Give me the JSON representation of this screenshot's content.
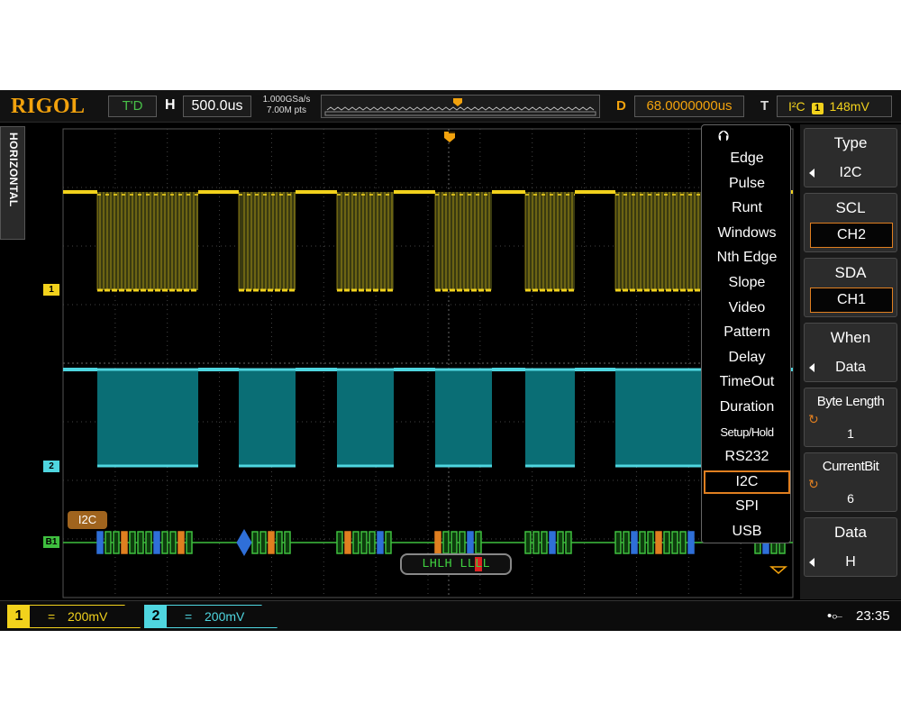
{
  "header": {
    "brand": "RIGOL",
    "run_status": "T'D",
    "horizontal_label": "H",
    "timebase": "500.0us",
    "sample_rate": "1.000GSa/s",
    "memory_depth": "7.00M pts",
    "delay_label": "D",
    "delay_value": "68.0000000us",
    "trigger_label": "T",
    "trigger_type": "I²C",
    "trigger_source": "1",
    "trigger_level": "148mV"
  },
  "side_tab": {
    "label": "HORIZONTAL"
  },
  "markers": {
    "ch1": "1",
    "ch2": "2",
    "bus": "B1"
  },
  "decode": {
    "bus_label": "I2C",
    "readout_pre": "LHLH LL",
    "readout_hl": "L",
    "readout_post": "L"
  },
  "trigger_menu": {
    "items": [
      "Edge",
      "Pulse",
      "Runt",
      "Windows",
      "Nth Edge",
      "Slope",
      "Video",
      "Pattern",
      "Delay",
      "TimeOut",
      "Duration",
      "Setup/Hold",
      "RS232",
      "I2C",
      "SPI",
      "USB"
    ],
    "selected": "I2C"
  },
  "softkeys": {
    "type": {
      "title": "Type",
      "value": "I2C"
    },
    "scl": {
      "title": "SCL",
      "value": "CH2"
    },
    "sda": {
      "title": "SDA",
      "value": "CH1"
    },
    "when": {
      "title": "When",
      "value": "Data"
    },
    "byte_length": {
      "title": "Byte Length",
      "value": "1"
    },
    "current_bit": {
      "title": "CurrentBit",
      "value": "6"
    },
    "data": {
      "title": "Data",
      "value": "H"
    }
  },
  "footer": {
    "ch1": {
      "num": "1",
      "coupling": "=",
      "scale": "200mV"
    },
    "ch2": {
      "num": "2",
      "coupling": "=",
      "scale": "200mV"
    },
    "time": "23:35"
  },
  "colors": {
    "ch1": "#f2d21c",
    "ch2": "#4fd6e0",
    "bus": "#3fbf3f",
    "accent": "#e07f20"
  },
  "waveform": {
    "bursts": [
      [
        108,
        220
      ],
      [
        265,
        328
      ],
      [
        374,
        437
      ],
      [
        483,
        546
      ],
      [
        583,
        638
      ],
      [
        683,
        780
      ]
    ],
    "bus_packets": [
      [
        108,
        218
      ],
      [
        280,
        325
      ],
      [
        374,
        436
      ],
      [
        483,
        536
      ],
      [
        583,
        636
      ],
      [
        683,
        778
      ],
      [
        838,
        878
      ]
    ]
  }
}
